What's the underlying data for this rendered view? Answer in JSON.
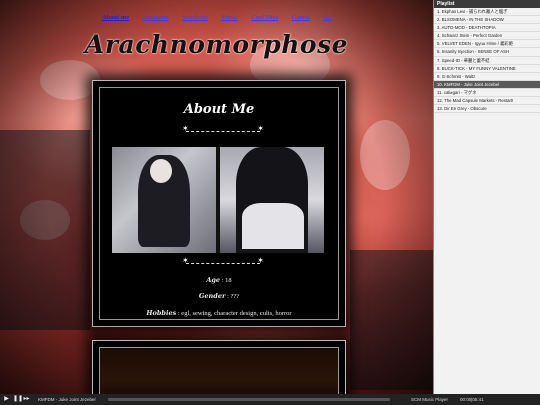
{
  "nav": {
    "links": [
      "About me",
      "Instagram",
      "Wardrobe",
      "Music",
      "Cool Sites",
      "Games",
      "etc"
    ]
  },
  "site": {
    "title": "Arachnomorphose"
  },
  "about": {
    "heading": "About Me",
    "age_label": "Age",
    "age_value": ": 18",
    "gender_label": "Gender",
    "gender_value": ": ???",
    "hobbies_label": "Hobbies",
    "hobbies_value": ": egl, sewing, character design, cults, horror"
  },
  "playlist": {
    "title": "Playlist",
    "tracks": [
      "1. Ekphas Levi - 捕らわれ離人と騒ぎ",
      "2. BLSOMENA - IN THE SHADOW",
      "3. AUTO-MOD - DEATHTOPIA",
      "4. Schwarz Stein - Perfect Garden",
      "5. VELVET EDEN - Igyuu Hime / 義彩姫",
      "6. Insanity Injection - SENSE OF ASH",
      "7. Speed-ID - 華麗と蕾不結",
      "8. BUCK-TICK - MY FUNNY VALENTINE",
      "9. G-Schmitt - Waltz",
      "10. KMFDM - Juke Joint Jezebel",
      "11. cali≠gari - マグネ",
      "12. The Mad Capsule Markets - Restart!",
      "13. Dir En Grey - Obscure"
    ],
    "active_index": 9
  },
  "player": {
    "now_playing": "KMFDM - Juke Joint Jezebel",
    "name": "SCM Music Player",
    "time": "00:00|05:41",
    "progress": 0.0
  },
  "colors": {
    "nav_link": "#3a3aff",
    "panel_bg": "#000000",
    "playlist_active": "#5a5a5a",
    "player_bg": "#222222"
  }
}
